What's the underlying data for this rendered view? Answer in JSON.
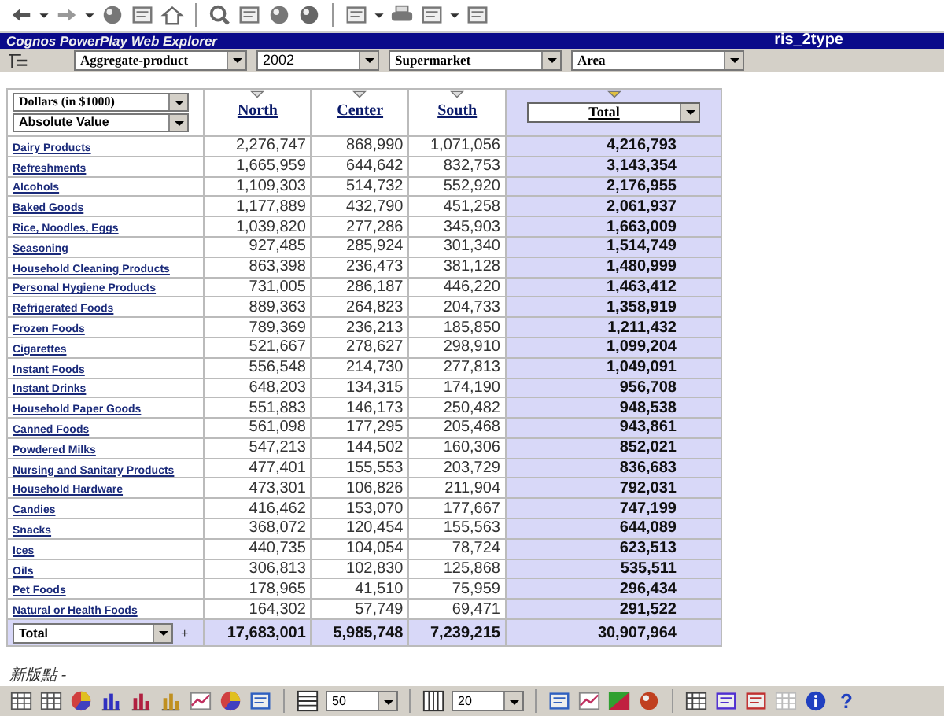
{
  "title_bar": {
    "app_title": "Cognos PowerPlay Web Explorer",
    "report_name": "ris_2type"
  },
  "filters": [
    {
      "value": "Aggregate-product",
      "serif": true
    },
    {
      "value": "2002",
      "serif": false
    },
    {
      "value": "Supermarket",
      "serif": true
    },
    {
      "value": "Area",
      "serif": true
    }
  ],
  "measure": {
    "value": "Dollars (in $1000)"
  },
  "display": {
    "value": "Absolute Value"
  },
  "columns": [
    {
      "label": "North",
      "kind": "link",
      "highlighted": false
    },
    {
      "label": "Center",
      "kind": "link",
      "highlighted": false
    },
    {
      "label": "South",
      "kind": "link",
      "highlighted": false
    },
    {
      "label": "Total",
      "kind": "dropdown",
      "highlighted": true
    }
  ],
  "rows": [
    {
      "label": "Dairy Products",
      "values": [
        "2,276,747",
        "868,990",
        "1,071,056",
        "4,216,793"
      ]
    },
    {
      "label": "Refreshments",
      "values": [
        "1,665,959",
        "644,642",
        "832,753",
        "3,143,354"
      ]
    },
    {
      "label": "Alcohols",
      "values": [
        "1,109,303",
        "514,732",
        "552,920",
        "2,176,955"
      ]
    },
    {
      "label": "Baked Goods",
      "values": [
        "1,177,889",
        "432,790",
        "451,258",
        "2,061,937"
      ]
    },
    {
      "label": "Rice, Noodles, Eggs",
      "values": [
        "1,039,820",
        "277,286",
        "345,903",
        "1,663,009"
      ]
    },
    {
      "label": "Seasoning",
      "values": [
        "927,485",
        "285,924",
        "301,340",
        "1,514,749"
      ]
    },
    {
      "label": "Household Cleaning Products",
      "values": [
        "863,398",
        "236,473",
        "381,128",
        "1,480,999"
      ]
    },
    {
      "label": "Personal Hygiene Products",
      "values": [
        "731,005",
        "286,187",
        "446,220",
        "1,463,412"
      ]
    },
    {
      "label": "Refrigerated Foods",
      "values": [
        "889,363",
        "264,823",
        "204,733",
        "1,358,919"
      ]
    },
    {
      "label": "Frozen Foods",
      "values": [
        "789,369",
        "236,213",
        "185,850",
        "1,211,432"
      ]
    },
    {
      "label": "Cigarettes",
      "values": [
        "521,667",
        "278,627",
        "298,910",
        "1,099,204"
      ]
    },
    {
      "label": "Instant Foods",
      "values": [
        "556,548",
        "214,730",
        "277,813",
        "1,049,091"
      ]
    },
    {
      "label": "Instant Drinks",
      "values": [
        "648,203",
        "134,315",
        "174,190",
        "956,708"
      ]
    },
    {
      "label": "Household Paper Goods",
      "values": [
        "551,883",
        "146,173",
        "250,482",
        "948,538"
      ]
    },
    {
      "label": "Canned Foods",
      "values": [
        "561,098",
        "177,295",
        "205,468",
        "943,861"
      ]
    },
    {
      "label": "Powdered Milks",
      "values": [
        "547,213",
        "144,502",
        "160,306",
        "852,021"
      ]
    },
    {
      "label": "Nursing and Sanitary Products",
      "values": [
        "477,401",
        "155,553",
        "203,729",
        "836,683"
      ]
    },
    {
      "label": "Household Hardware",
      "values": [
        "473,301",
        "106,826",
        "211,904",
        "792,031"
      ]
    },
    {
      "label": "Candies",
      "values": [
        "416,462",
        "153,070",
        "177,667",
        "747,199"
      ]
    },
    {
      "label": "Snacks",
      "values": [
        "368,072",
        "120,454",
        "155,563",
        "644,089"
      ]
    },
    {
      "label": "Ices",
      "values": [
        "440,735",
        "104,054",
        "78,724",
        "623,513"
      ]
    },
    {
      "label": "Oils",
      "values": [
        "306,813",
        "102,830",
        "125,868",
        "535,511"
      ]
    },
    {
      "label": "Pet Foods",
      "values": [
        "178,965",
        "41,510",
        "75,959",
        "296,434"
      ]
    },
    {
      "label": "Natural or Health Foods",
      "values": [
        "164,302",
        "57,749",
        "69,471",
        "291,522"
      ]
    }
  ],
  "total_row": {
    "label": "Total",
    "add": "+",
    "values": [
      "17,683,001",
      "5,985,748",
      "7,239,215",
      "30,907,964"
    ]
  },
  "footer_label": "新版點 -",
  "bottom_toolbar": {
    "rows_per_page": "50",
    "columns_per_page": "20",
    "help": "?"
  }
}
